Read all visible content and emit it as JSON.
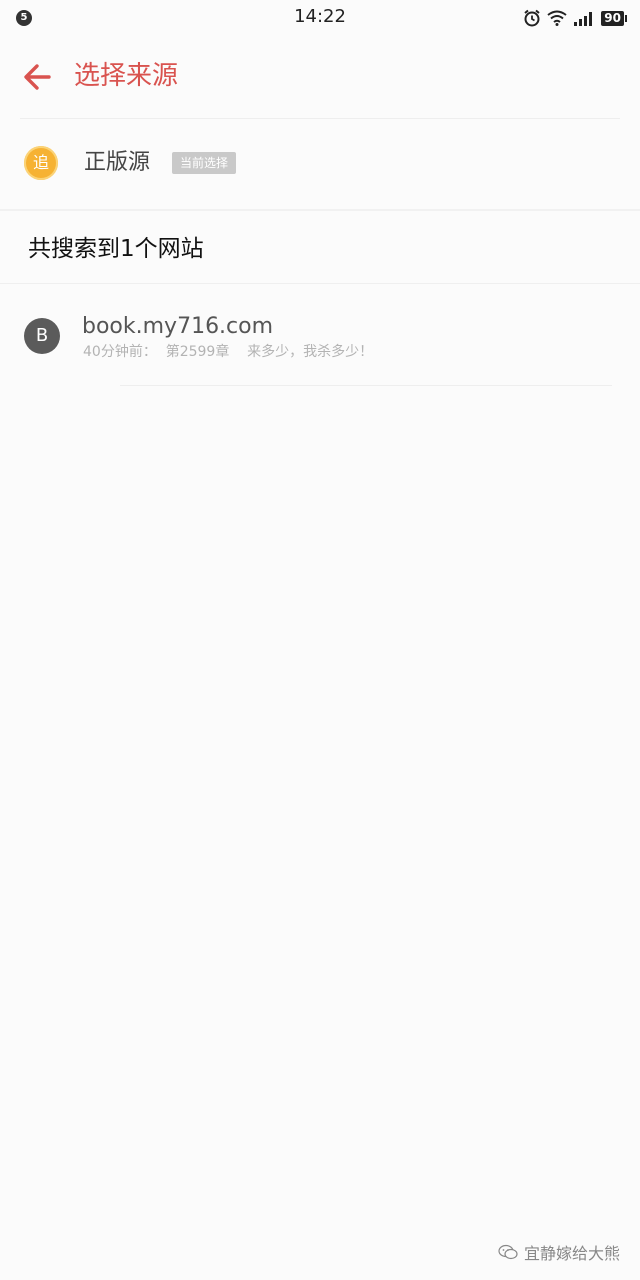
{
  "status_bar": {
    "notification_count": "5",
    "time": "14:22",
    "battery": "90",
    "icons": [
      "alarm-icon",
      "wifi-icon",
      "signal-icon",
      "battery-icon"
    ]
  },
  "app_bar": {
    "title": "选择来源",
    "back_icon": "back-arrow-icon",
    "accent_color": "#d9534f"
  },
  "official_source": {
    "logo_text": "追",
    "name": "正版源",
    "badge": "当前选择",
    "logo_color": "#f6b233"
  },
  "results": {
    "title": "共搜索到1个网站",
    "items": [
      {
        "avatar_letter": "B",
        "domain": "book.my716.com",
        "subtitle": "40分钟前：  第2599章    来多少，我杀多少！"
      }
    ]
  },
  "watermark": {
    "text": "宜静嫁给大熊",
    "icon": "wechat-icon"
  }
}
